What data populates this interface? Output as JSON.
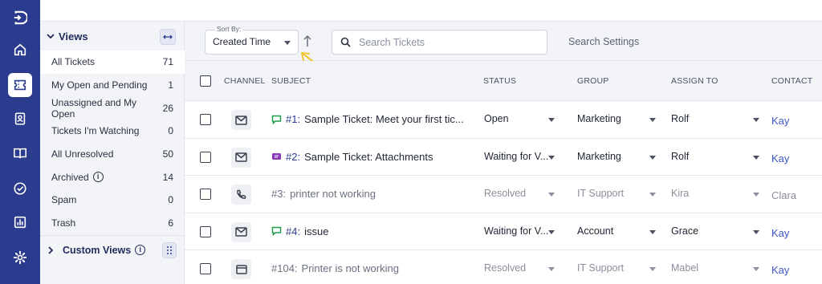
{
  "rail": {
    "items": [
      {
        "icon": "logout-icon"
      },
      {
        "icon": "home-icon"
      },
      {
        "icon": "ticket-icon",
        "active": true
      },
      {
        "icon": "contact-card-icon"
      },
      {
        "icon": "knowledge-base-icon"
      },
      {
        "icon": "tasks-check-icon"
      },
      {
        "icon": "reports-chart-icon"
      },
      {
        "icon": "settings-gear-icon"
      }
    ]
  },
  "views": {
    "title": "Views",
    "items": [
      {
        "label": "All Tickets",
        "count": "71"
      },
      {
        "label": "My Open and Pending",
        "count": "1"
      },
      {
        "label": "Unassigned and My Open",
        "count": "26"
      },
      {
        "label": "Tickets I'm Watching",
        "count": "0"
      },
      {
        "label": "All Unresolved",
        "count": "50"
      },
      {
        "label": "Archived",
        "count": "14",
        "info": true
      },
      {
        "label": "Spam",
        "count": "0"
      },
      {
        "label": "Trash",
        "count": "6"
      }
    ],
    "custom_views_label": "Custom Views"
  },
  "toolbar": {
    "sort_label": "Sort By:",
    "sort_value": "Created Time",
    "search_placeholder": "Search Tickets",
    "search_settings": "Search Settings"
  },
  "table": {
    "headers": {
      "channel": "CHANNEL",
      "subject": "SUBJECT",
      "status": "STATUS",
      "group": "GROUP",
      "assign_to": "ASSIGN TO",
      "contact": "CONTACT"
    },
    "rows": [
      {
        "channel_icon": "email-icon",
        "tag_icon": "chat-bubble-green-icon",
        "ticket_id": "#1:",
        "subject": "Sample Ticket: Meet your first tic...",
        "status": "Open",
        "group": "Marketing",
        "assignee": "Rolf",
        "contact": "Kay",
        "muted": false
      },
      {
        "channel_icon": "email-icon",
        "tag_icon": "ticket-purple-icon",
        "ticket_id": "#2:",
        "subject": "Sample Ticket: Attachments",
        "status": "Waiting for V...",
        "group": "Marketing",
        "assignee": "Rolf",
        "contact": "Kay",
        "muted": false
      },
      {
        "channel_icon": "phone-icon",
        "tag_icon": "",
        "ticket_id": "#3:",
        "subject": "printer not working",
        "status": "Resolved",
        "group": "IT Support",
        "assignee": "Kira",
        "contact": "Clara",
        "muted": true
      },
      {
        "channel_icon": "email-icon",
        "tag_icon": "chat-bubble-green-icon",
        "ticket_id": "#4:",
        "subject": "issue",
        "status": "Waiting for V...",
        "group": "Account",
        "assignee": "Grace",
        "contact": "Kay",
        "muted": false
      },
      {
        "channel_icon": "web-form-icon",
        "tag_icon": "",
        "ticket_id": "#104:",
        "subject": "Printer is not working",
        "status": "Resolved",
        "group": "IT Support",
        "assignee": "Mabel",
        "contact": "Kay",
        "muted": true
      }
    ]
  },
  "colors": {
    "rail_bg": "#2b3c8f",
    "panel_bg": "#f3f4f7",
    "link": "#3d56c4",
    "annotation_arrow": "#f0c531",
    "chat_green": "#1e9e4a",
    "ticket_purple": "#8a3ab9"
  }
}
